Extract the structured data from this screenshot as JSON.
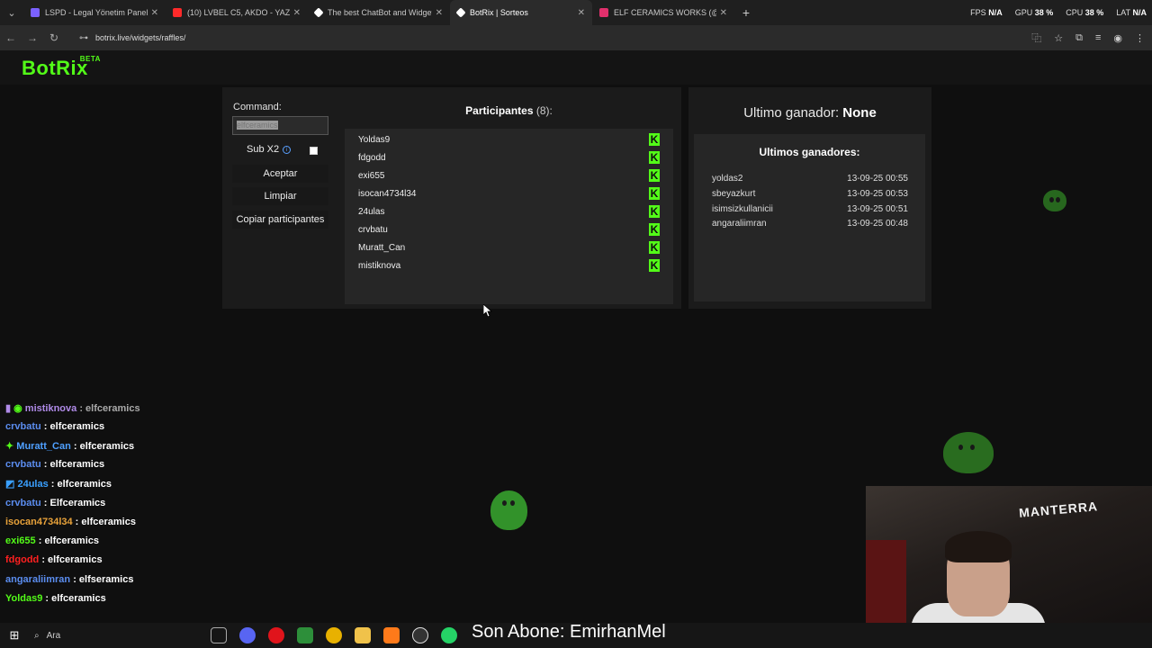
{
  "browser": {
    "tabs": [
      {
        "label": "LSPD - Legal Yönetim Paneli",
        "color": "#7b61ff"
      },
      {
        "label": "(10) LVBEL C5, AKDO - YAZ",
        "color": "#ff2a2a"
      },
      {
        "label": "The best ChatBot and Widgets",
        "color": "#ffffff"
      },
      {
        "label": "BotRix | Sorteos",
        "color": "#ffffff"
      },
      {
        "label": "ELF CERAMICS WORKS (@elfc",
        "color": "#e1306c"
      }
    ],
    "perf": {
      "fps_label": "FPS",
      "fps": "N/A",
      "gpu_label": "GPU",
      "gpu": "38 %",
      "cpu_label": "CPU",
      "cpu": "38 %",
      "lat_label": "LAT",
      "lat": "N/A"
    },
    "url": "botrix.live/widgets/raffles/"
  },
  "app": {
    "logo": "BotRix",
    "beta": "BETA",
    "brand_color": "#53fc18"
  },
  "controls": {
    "command_label": "Command:",
    "command_value": "elfceramics",
    "sub_label": "Sub X2",
    "accept": "Aceptar",
    "clear": "Limpiar",
    "copy": "Copiar participantes"
  },
  "participants": {
    "title": "Participantes",
    "count": "(8):",
    "list": [
      "Yoldas9",
      "fdgodd",
      "exi655",
      "isocan4734l34",
      "24ulas",
      "crvbatu",
      "Muratt_Can",
      "mistiknova"
    ]
  },
  "winners": {
    "last_label": "Ultimo ganador:",
    "last_value": "None",
    "title": "Ultimos ganadores:",
    "list": [
      {
        "name": "yoldas2",
        "time": "13-09-25 00:55"
      },
      {
        "name": "sbeyazkurt",
        "time": "13-09-25 00:53"
      },
      {
        "name": "isimsizkullanicii",
        "time": "13-09-25 00:51"
      },
      {
        "name": "angaraliimran",
        "time": "13-09-25 00:48"
      }
    ]
  },
  "chat": [
    {
      "user": "mistiknova",
      "msg": "elfceramics",
      "color": "#b08be8"
    },
    {
      "user": "crvbatu",
      "msg": "elfceramics",
      "color": "#5b8def"
    },
    {
      "user": "Muratt_Can",
      "msg": "elfceramics",
      "color": "#4fa0ff"
    },
    {
      "user": "crvbatu",
      "msg": "elfceramics",
      "color": "#5b8def"
    },
    {
      "user": "24ulas",
      "msg": "elfceramics",
      "color": "#3aa0ff"
    },
    {
      "user": "crvbatu",
      "msg": "Elfceramics",
      "color": "#5b8def"
    },
    {
      "user": "isocan4734l34",
      "msg": "elfceramics",
      "color": "#e8a23a"
    },
    {
      "user": "exi655",
      "msg": "elfceramics",
      "color": "#53fc18"
    },
    {
      "user": "fdgodd",
      "msg": "elfceramics",
      "color": "#ff2020"
    },
    {
      "user": "angaraliimran",
      "msg": "elfseramics",
      "color": "#5b8def"
    },
    {
      "user": "Yoldas9",
      "msg": "elfceramics",
      "color": "#53fc18"
    }
  ],
  "stream": {
    "webcam_sign": "MANTERRA",
    "subtitle": "Son Abone: EmirhanMel"
  },
  "taskbar": {
    "search": "Ara"
  }
}
